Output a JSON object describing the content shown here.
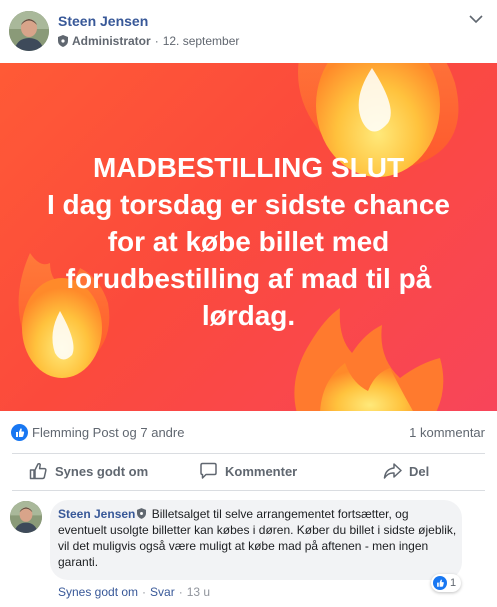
{
  "post": {
    "author": "Steen Jensen",
    "role": "Administrator",
    "date": "12. september",
    "banner_lines": [
      "MADBESTILLING SLUT",
      "I dag torsdag er sidste chance",
      "for at købe billet med",
      "forudbestilling af mad til på",
      "lørdag."
    ]
  },
  "reactions": {
    "reactors": "Flemming Post og 7 andre",
    "comment_count": "1 kommentar"
  },
  "actions": {
    "like": "Synes godt om",
    "comment": "Kommenter",
    "share": "Del"
  },
  "comment": {
    "author": "Steen Jensen",
    "text": " Billetsalget til selve arrangementet fortsætter, og eventuelt usolgte billetter kan købes i døren. Køber du billet i sidste øjeblik, vil det muligvis også være muligt at købe mad på aftenen - men ingen garanti.",
    "like_action": "Synes godt om",
    "reply_action": "Svar",
    "separator": "·",
    "time": "13 u",
    "reaction_count": "1"
  },
  "colors": {
    "link_blue": "#385898",
    "like_blue": "#1877f2",
    "banner_orange": "#ff5a36"
  }
}
